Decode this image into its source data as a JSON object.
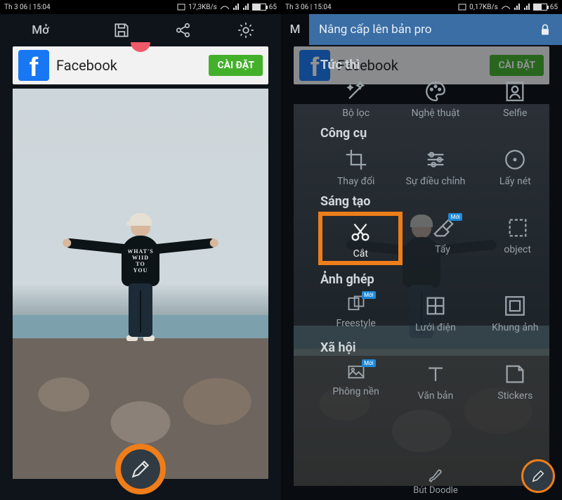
{
  "status": {
    "time_day": "Th 3 06",
    "time_clock": "15:04",
    "speed_left": "17,3KB/s",
    "speed_right": "0,17KB/s",
    "battery": "65"
  },
  "toolbar": {
    "open": "Mở"
  },
  "ad": {
    "name": "Facebook",
    "install": "CÀI ĐẶT",
    "logo_letter": "f"
  },
  "hoodie": {
    "l1": "WHAT'S",
    "l2": "WIID",
    "l3": "TO",
    "l4": "YOU"
  },
  "upgrade": "Nâng cấp lên bản pro",
  "sections": {
    "instant": "Tức thì",
    "tools": "Công cụ",
    "creative": "Sáng tạo",
    "collage": "Ảnh ghép",
    "social": "Xã hội"
  },
  "items": {
    "filter": "Bộ lọc",
    "art": "Nghệ thuật",
    "selfie": "Selfie",
    "transform": "Thay đổi",
    "adjust": "Sự điều chỉnh",
    "focus": "Lấy nét",
    "cut": "Cắt",
    "erase": "Tẩy",
    "object": "object",
    "freestyle": "Freestyle",
    "grid": "Lưới điện",
    "frame": "Khung ảnh",
    "bg": "Phông nền",
    "text": "Văn bản",
    "stickers": "Stickers",
    "doodle": "Bút Doodle"
  },
  "badge": "Mới"
}
